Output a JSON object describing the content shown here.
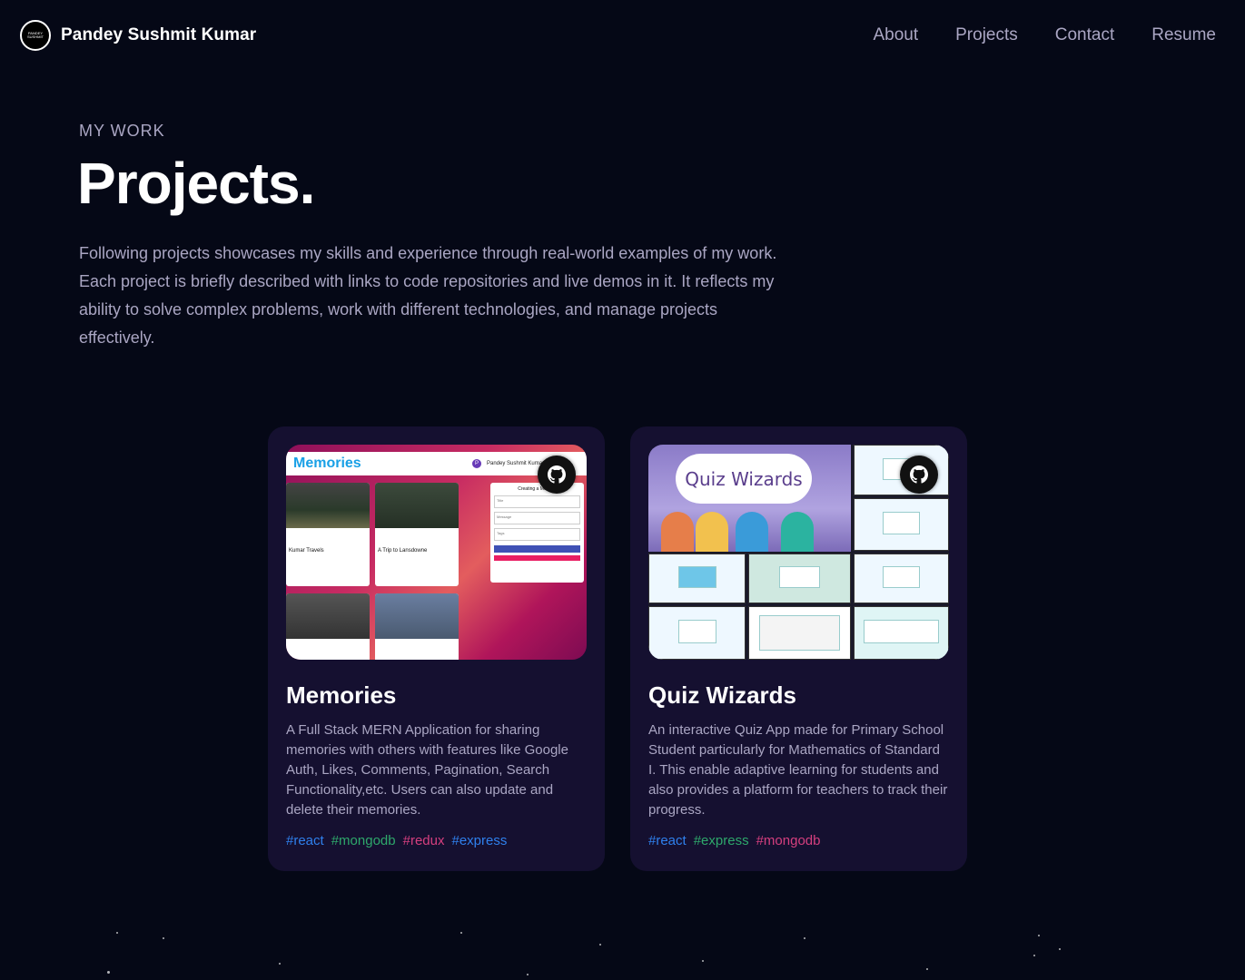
{
  "nav": {
    "logo_text": "PANDEY SUSHMIT",
    "brand": "Pandey Sushmit  Kumar",
    "links": [
      "About",
      "Projects",
      "Contact",
      "Resume"
    ]
  },
  "header": {
    "subtitle": "MY WORK",
    "title": "Projects.",
    "intro": "Following projects showcases my skills and experience through real-world examples of my work. Each project is briefly described with links to code repositories and live demos in it. It reflects my ability to solve complex problems, work with different technologies, and manage projects effectively."
  },
  "projects": [
    {
      "name": "Memories",
      "description": "A Full Stack MERN Application for sharing memories with others with features like Google Auth, Likes, Comments, Pagination, Search Functionality,etc. Users can also update and delete their memories.",
      "tags": [
        "#react",
        "#mongodb",
        "#redux",
        "#express"
      ],
      "thumbnail": {
        "app_title": "Memories",
        "user": "Pandey Sushmit Kumar",
        "avatar_letter": "P",
        "posts": [
          "Kumar Travels",
          "A Trip to Lansdowne"
        ],
        "form_title": "Creating a Memory",
        "form_fields": [
          "Title",
          "Message",
          "Tags"
        ]
      }
    },
    {
      "name": "Quiz Wizards",
      "description": "An interactive Quiz App made for Primary School Student particularly for Mathematics of Standard I. This enable adaptive learning for students and also provides a platform for teachers to track their progress.",
      "tags": [
        "#react",
        "#express",
        "#mongodb"
      ],
      "thumbnail": {
        "banner": "Quiz Wizards"
      }
    }
  ],
  "colors": {
    "background": "#050816",
    "card": "#151030",
    "secondary_text": "#aaa6c3",
    "tag_blue": "#2f80ed",
    "tag_green": "#2ea86b",
    "tag_pink": "#d63f7f"
  },
  "icons": [
    "github-icon"
  ]
}
